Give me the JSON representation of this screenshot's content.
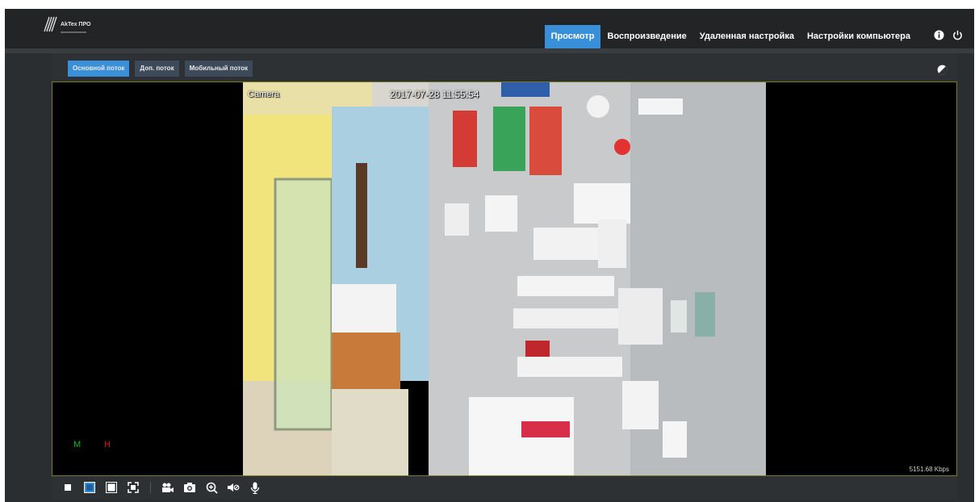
{
  "app": {
    "logo_text": "AkTex ПРО"
  },
  "nav": {
    "items": [
      {
        "label": "Просмотр",
        "active": true
      },
      {
        "label": "Воспроизведение",
        "active": false
      },
      {
        "label": "Удаленная настройка",
        "active": false
      },
      {
        "label": "Настройки компьютера",
        "active": false
      }
    ],
    "icons": [
      "info-icon",
      "power-icon"
    ]
  },
  "stream_tabs": [
    {
      "label": "Основной поток",
      "active": true
    },
    {
      "label": "Доп. поток",
      "active": false
    },
    {
      "label": "Мобильный поток",
      "active": false
    }
  ],
  "video": {
    "camera_name": "Camera",
    "timestamp": "2017-07-28 11:55:54",
    "marker_m": "M",
    "marker_h": "H",
    "bitrate": "5151.68 Kbps"
  },
  "toolbar": {
    "icons": [
      "stop-icon",
      "layout-single-icon",
      "layout-window-icon",
      "fullscreen-icon",
      "record-icon",
      "snapshot-icon",
      "zoom-in-icon",
      "mute-icon",
      "microphone-icon"
    ]
  },
  "colors": {
    "accent": "#3a8fd9",
    "background": "#2b2e31",
    "marker_m": "#1db52a",
    "marker_h": "#e0101a"
  }
}
